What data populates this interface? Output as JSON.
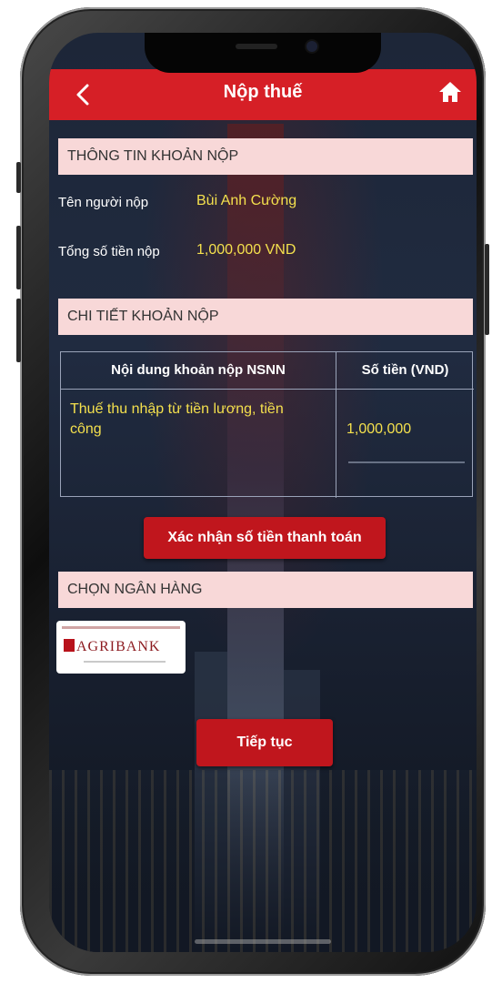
{
  "header": {
    "title": "Nộp thuế",
    "back_icon": "chevron-left-icon",
    "home_icon": "home-icon"
  },
  "payment_info": {
    "section_title": "THÔNG TIN KHOẢN NỘP",
    "payer_label": "Tên người nộp",
    "payer_value": "Bùi Anh Cường",
    "total_label": "Tổng số tiền nộp",
    "total_value": "1,000,000 VND"
  },
  "payment_detail": {
    "section_title": "CHI TIẾT KHOẢN NỘP",
    "columns": [
      "Nội dung khoản nộp NSNN",
      "Số tiền (VND)"
    ],
    "rows": [
      {
        "content": "Thuế thu nhập từ tiền lương, tiền công",
        "amount": "1,000,000"
      }
    ]
  },
  "confirm_button": "Xác nhận số tiền thanh toán",
  "bank_select": {
    "section_title": "CHỌN NGÂN HÀNG",
    "banks": [
      {
        "name": "AGRIBANK"
      }
    ]
  },
  "continue_button": "Tiếp tục",
  "colors": {
    "header": "#d61f26",
    "section_bar": "#f8d8d8",
    "value_text": "#f4e04d",
    "button": "#c0161d"
  }
}
